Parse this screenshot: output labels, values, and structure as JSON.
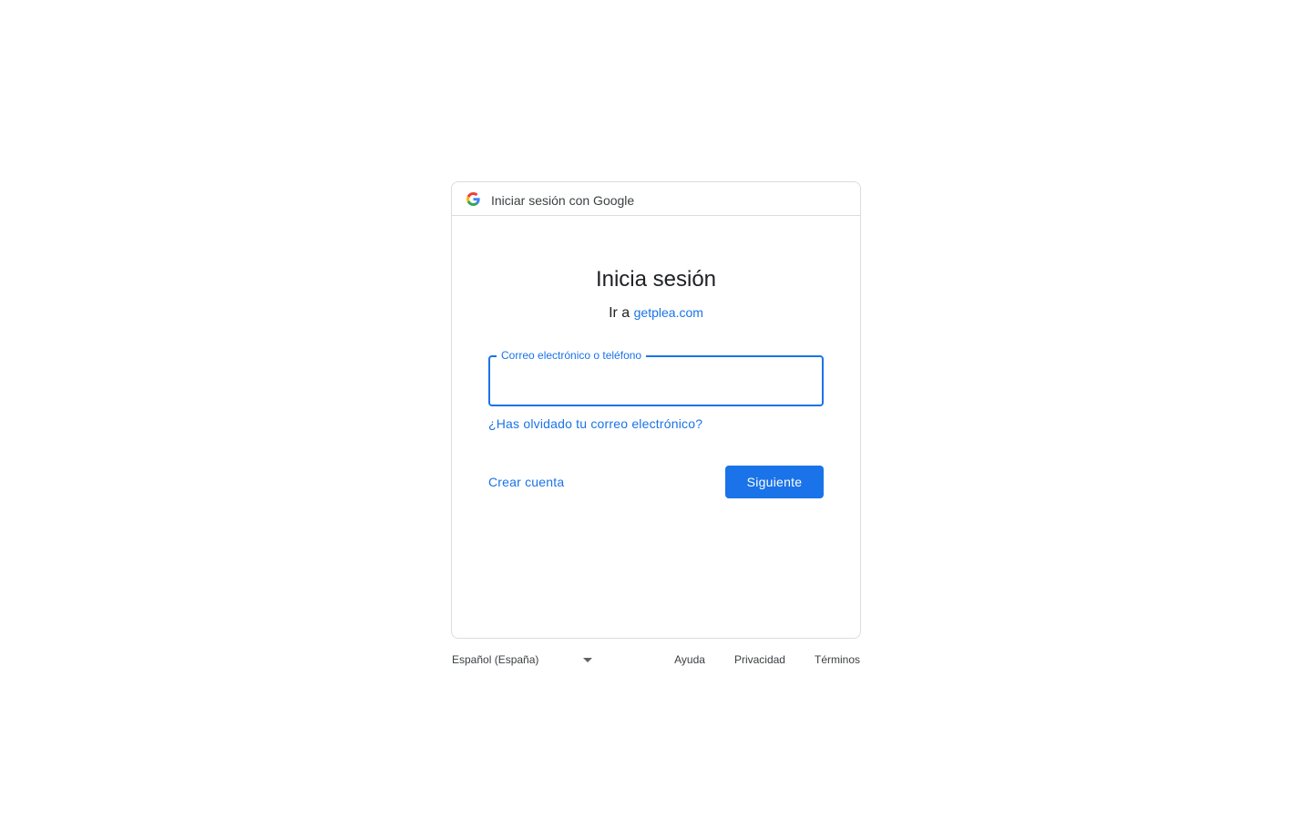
{
  "header": {
    "title": "Iniciar sesión con Google",
    "logo_icon": "google-g-icon"
  },
  "main": {
    "heading": "Inicia sesión",
    "subheading_prefix": "Ir a",
    "subheading_link": "getplea.com",
    "email_field": {
      "label": "Correo electrónico o teléfono",
      "value": "",
      "state": "focused"
    },
    "forgot_email_link": "¿Has olvidado tu correo electrónico?",
    "create_account_link": "Crear cuenta",
    "next_button": "Siguiente"
  },
  "footer": {
    "language": "Español (España)",
    "language_icon": "caret-down-icon",
    "links": [
      "Ayuda",
      "Privacidad",
      "Términos"
    ]
  },
  "colors": {
    "accent": "#1a73e8",
    "border": "#dadce0",
    "text": "#202124",
    "muted_text": "#3c4043"
  }
}
